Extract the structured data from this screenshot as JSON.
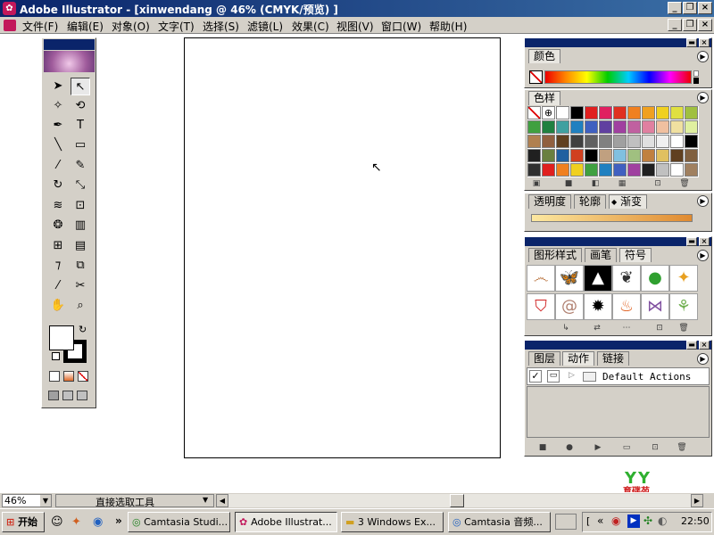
{
  "window": {
    "title": "Adobe Illustrator - [xinwendang @ 46% (CMYK/预览) ]",
    "app_icon": "illustrator-icon"
  },
  "menu": [
    "文件(F)",
    "编辑(E)",
    "对象(O)",
    "文字(T)",
    "选择(S)",
    "滤镜(L)",
    "效果(C)",
    "视图(V)",
    "窗口(W)",
    "帮助(H)"
  ],
  "toolbox": {
    "tools": [
      {
        "name": "selection-tool",
        "glyph": "➤"
      },
      {
        "name": "direct-selection-tool",
        "glyph": "↖"
      },
      {
        "name": "magic-wand-tool",
        "glyph": "✧"
      },
      {
        "name": "lasso-tool",
        "glyph": "⟲"
      },
      {
        "name": "pen-tool",
        "glyph": "✒"
      },
      {
        "name": "type-tool",
        "glyph": "T"
      },
      {
        "name": "line-tool",
        "glyph": "╲"
      },
      {
        "name": "rectangle-tool",
        "glyph": "▭"
      },
      {
        "name": "paintbrush-tool",
        "glyph": "⁄"
      },
      {
        "name": "pencil-tool",
        "glyph": "✎"
      },
      {
        "name": "rotate-tool",
        "glyph": "↻"
      },
      {
        "name": "scale-tool",
        "glyph": "⤡"
      },
      {
        "name": "warp-tool",
        "glyph": "≋"
      },
      {
        "name": "free-transform-tool",
        "glyph": "⊡"
      },
      {
        "name": "symbol-sprayer-tool",
        "glyph": "❂"
      },
      {
        "name": "graph-tool",
        "glyph": "▥"
      },
      {
        "name": "mesh-tool",
        "glyph": "⊞"
      },
      {
        "name": "gradient-tool",
        "glyph": "▤"
      },
      {
        "name": "eyedropper-tool",
        "glyph": "⁊"
      },
      {
        "name": "blend-tool",
        "glyph": "⧉"
      },
      {
        "name": "slice-tool",
        "glyph": "⁄"
      },
      {
        "name": "scissors-tool",
        "glyph": "✂"
      },
      {
        "name": "hand-tool",
        "glyph": "✋"
      },
      {
        "name": "zoom-tool",
        "glyph": "⌕"
      }
    ],
    "active_tool": "direct-selection-tool"
  },
  "palettes": {
    "color": {
      "tab": "颜色"
    },
    "swatches": {
      "tab": "色样"
    },
    "gradient_group": {
      "tabs": [
        "透明度",
        "轮廓",
        "渐变"
      ],
      "active": "渐变"
    },
    "styles_group": {
      "tabs": [
        "图形样式",
        "画笔",
        "符号"
      ],
      "active": "符号"
    },
    "layers_group": {
      "tabs": [
        "图层",
        "动作",
        "链接"
      ],
      "active": "动作",
      "action_set": "Default Actions"
    }
  },
  "status": {
    "zoom": "46%",
    "tool_name": "直接选取工具"
  },
  "watermark": "育碟苑",
  "taskbar": {
    "start": "开始",
    "buttons": [
      "Camtasia Studi...",
      "Adobe Illustrat...",
      "3 Windows Ex...",
      "Camtasia 音频..."
    ],
    "active_index": 1,
    "clock": "22:50"
  },
  "colors": {
    "title_bar": "#0a246a",
    "panel": "#d4d0c8",
    "artboard": "#ffffff"
  }
}
